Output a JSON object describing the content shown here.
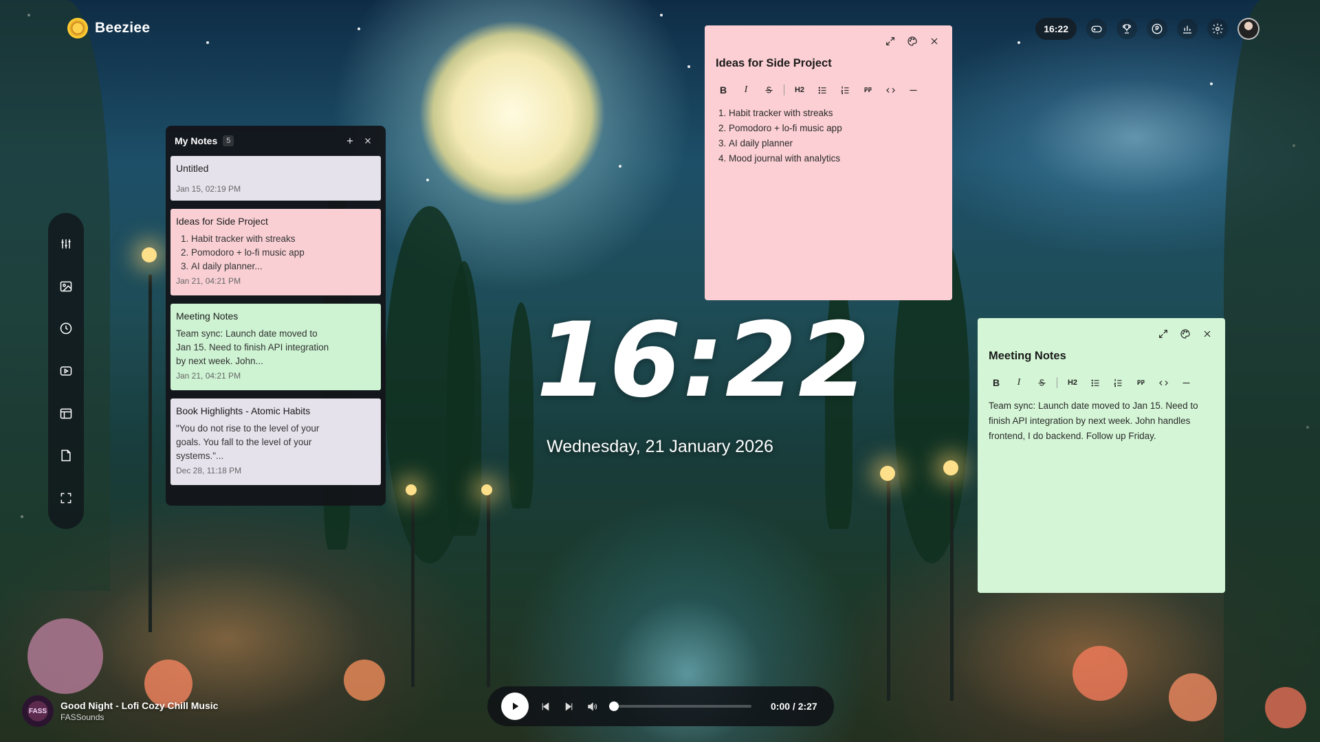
{
  "app": {
    "name": "Beeziee"
  },
  "topbar": {
    "time": "16:22",
    "icons": [
      "gamepad-icon",
      "trophy-icon",
      "help-icon",
      "stats-icon",
      "settings-icon"
    ]
  },
  "rail": {
    "items": [
      "mixer-icon",
      "image-icon",
      "clock-icon",
      "video-icon",
      "layout-icon",
      "notes-icon",
      "fullscreen-icon"
    ]
  },
  "notes_panel": {
    "title": "My Notes",
    "count": "5",
    "items": [
      {
        "title": "Untitled",
        "body": "",
        "date": "Jan 15, 02:19 PM",
        "color": "#e6e2ec"
      },
      {
        "title": "Ideas for Side Project",
        "list": [
          "Habit tracker with streaks",
          "Pomodoro + lo-fi music app",
          "AI daily planner..."
        ],
        "date": "Jan 21, 04:21 PM",
        "color": "#f9cfd4"
      },
      {
        "title": "Meeting Notes",
        "body": "Team sync: Launch date moved to Jan 15. Need to finish API integration by next week. John...",
        "date": "Jan 21, 04:21 PM",
        "color": "#cdf3d2"
      },
      {
        "title": "Book Highlights - Atomic Habits",
        "body": "\"You do not rise to the level of your goals. You fall to the level of your systems.\"...",
        "date": "Dec 28, 11:18 PM",
        "color": "#e6e2ec"
      }
    ]
  },
  "note_window_1": {
    "title": "Ideas for Side Project",
    "color": "#fbcfd3",
    "items": [
      "Habit tracker with streaks",
      "Pomodoro + lo-fi music app",
      "AI daily planner",
      "Mood journal with analytics"
    ]
  },
  "note_window_2": {
    "title": "Meeting Notes",
    "color": "#d4f6d6",
    "body": "Team sync: Launch date moved to Jan 15. Need to finish API integration by next week. John handles frontend, I do backend. Follow up Friday."
  },
  "toolbar": {
    "bold": "B",
    "italic": "I",
    "heading": "H2"
  },
  "clock": {
    "time": "16:22",
    "date": "Wednesday, 21 January 2026"
  },
  "music": {
    "art_label": "FASS",
    "title": "Good Night - Lofi Cozy Chill Music",
    "artist": "FASSounds",
    "time": "0:00 / 2:27",
    "progress": 0
  }
}
